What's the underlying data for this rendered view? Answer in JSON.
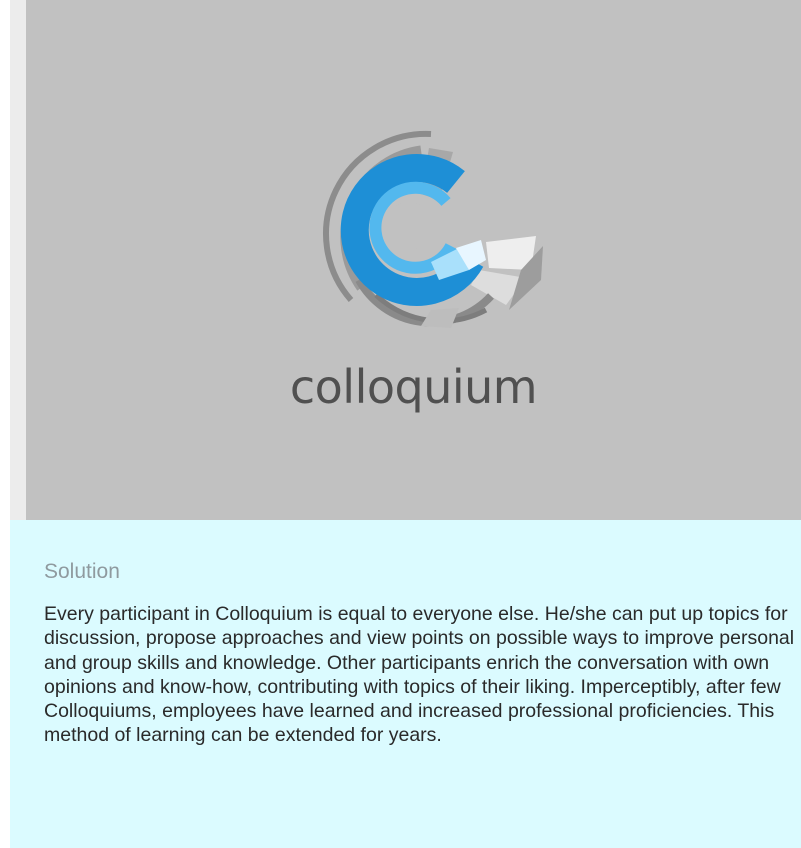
{
  "hero": {
    "brand_wordmark": "colloquium",
    "logo_icon": "colloquium-logo-icon",
    "colors": {
      "background": "#c1c1c1",
      "logo_blue": "#1e8fd6",
      "logo_light_blue": "#53b8ee",
      "logo_gray": "#8a8a8a",
      "wordmark": "#505050"
    }
  },
  "info": {
    "heading": "Solution",
    "body": "Every participant in Colloquium is equal to everyone else. He/she can put up topics for discussion, propose approaches and view points on possible ways to improve personal and group skills and knowledge. Other participants enrich the conversation with own opinions and know-how, contributing with topics of their liking. Imperceptibly, after few Colloquiums, employees have learned and increased professional proficiencies. This method of learning can be extended for years.",
    "colors": {
      "background": "#dbfbff",
      "heading": "#8f9a9f",
      "text": "#2a2a2a"
    }
  }
}
